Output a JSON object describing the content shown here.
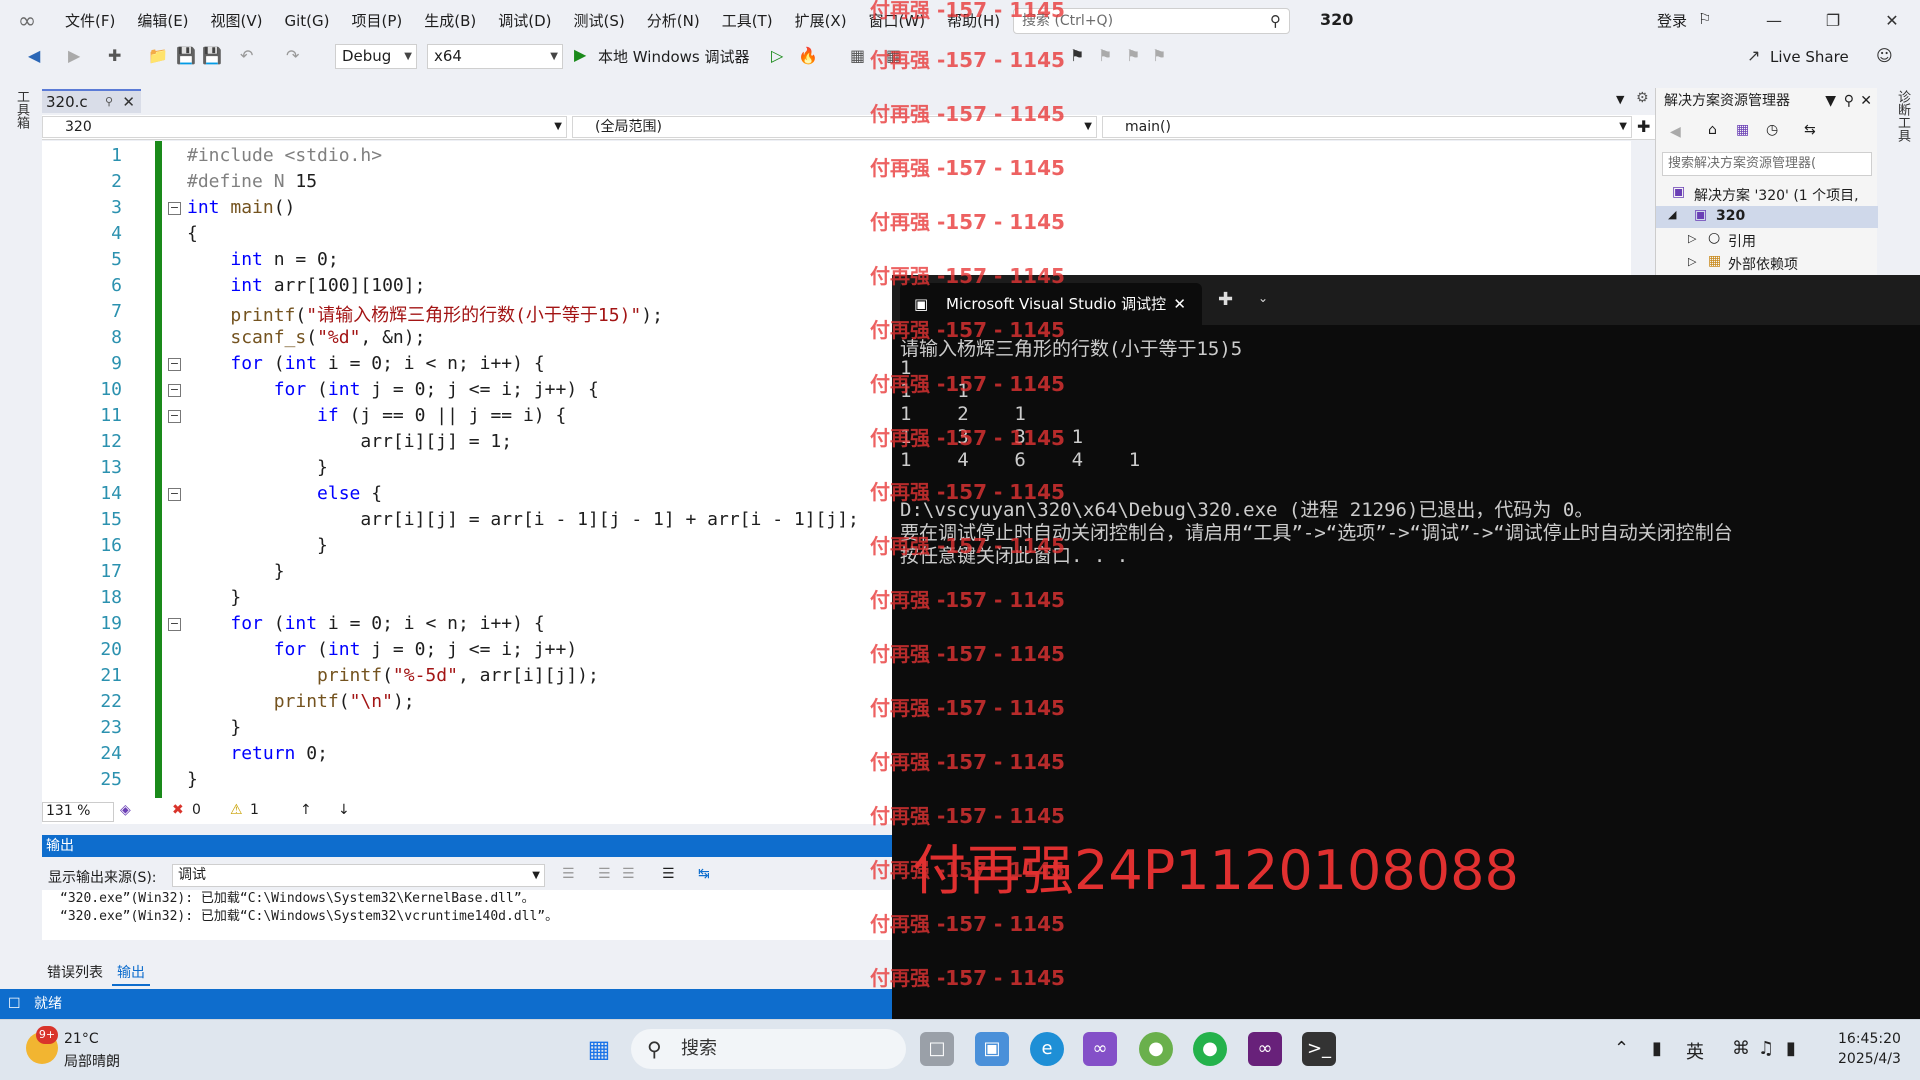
{
  "menu": {
    "items": [
      "文件(F)",
      "编辑(E)",
      "视图(V)",
      "Git(G)",
      "项目(P)",
      "生成(B)",
      "调试(D)",
      "测试(S)",
      "分析(N)",
      "工具(T)",
      "扩展(X)",
      "窗口(W)",
      "帮助(H)"
    ],
    "search_placeholder": "搜索 (Ctrl+Q)",
    "solution_name": "320",
    "login": "登录"
  },
  "toolbar": {
    "config": "Debug",
    "platform": "x64",
    "run_label": "本地 Windows 调试器",
    "live_share": "Live Share"
  },
  "side": {
    "left_tab": "工具箱",
    "right_tab": "诊断工具"
  },
  "editor": {
    "tab_name": "320.c",
    "nav_project": "320",
    "nav_scope": "(全局范围)",
    "nav_member": "main()",
    "line_numbers": [
      "1",
      "2",
      "3",
      "4",
      "5",
      "6",
      "7",
      "8",
      "9",
      "10",
      "11",
      "12",
      "13",
      "14",
      "15",
      "16",
      "17",
      "18",
      "19",
      "20",
      "21",
      "22",
      "23",
      "24",
      "25"
    ],
    "zoom": "131 %",
    "errors": "0",
    "warnings": "1"
  },
  "solution_explorer": {
    "title": "解决方案资源管理器",
    "search_placeholder": "搜索解决方案资源管理器(",
    "solution_item": "解决方案 '320' (1 个项目,",
    "project_item": "320",
    "references": "引用",
    "external_deps": "外部依赖项"
  },
  "output": {
    "title": "输出",
    "source_label": "显示输出来源(S):",
    "source_value": "调试",
    "lines": [
      "“320.exe”(Win32): 已加载“C:\\Windows\\System32\\KernelBase.dll”。",
      "“320.exe”(Win32): 已加载“C:\\Windows\\System32\\vcruntime140d.dll”。"
    ],
    "tabs": [
      "错误列表",
      "输出"
    ]
  },
  "statusbar": {
    "state": "就绪"
  },
  "console": {
    "tab_title": "Microsoft Visual Studio 调试控",
    "lines": [
      "请输入杨辉三角形的行数(小于等于15)5",
      "1",
      "1    1",
      "1    2    1",
      "1    3    3    1",
      "1    4    6    4    1",
      "",
      "D:\\vscyuyan\\320\\x64\\Debug\\320.exe (进程 21296)已退出，代码为 0。",
      "要在调试停止时自动关闭控制台，请启用“工具”->“选项”->“调试”->“调试停止时自动关闭控制台",
      "按任意键关闭此窗口. . ."
    ]
  },
  "watermark": {
    "repeat_text": "付再强 -157 - 1145",
    "big_text": "付再强24P1120108088"
  },
  "taskbar": {
    "weather_temp": "21°C",
    "weather_desc": "局部晴朗",
    "weather_badge": "9+",
    "search_label": "搜索",
    "ime": "英",
    "time": "16:45:20",
    "date": "2025/4/3"
  },
  "colors": {
    "accent": "#0e6dcd",
    "watermark": "#e83434",
    "change_bar": "#1a8a1a"
  }
}
